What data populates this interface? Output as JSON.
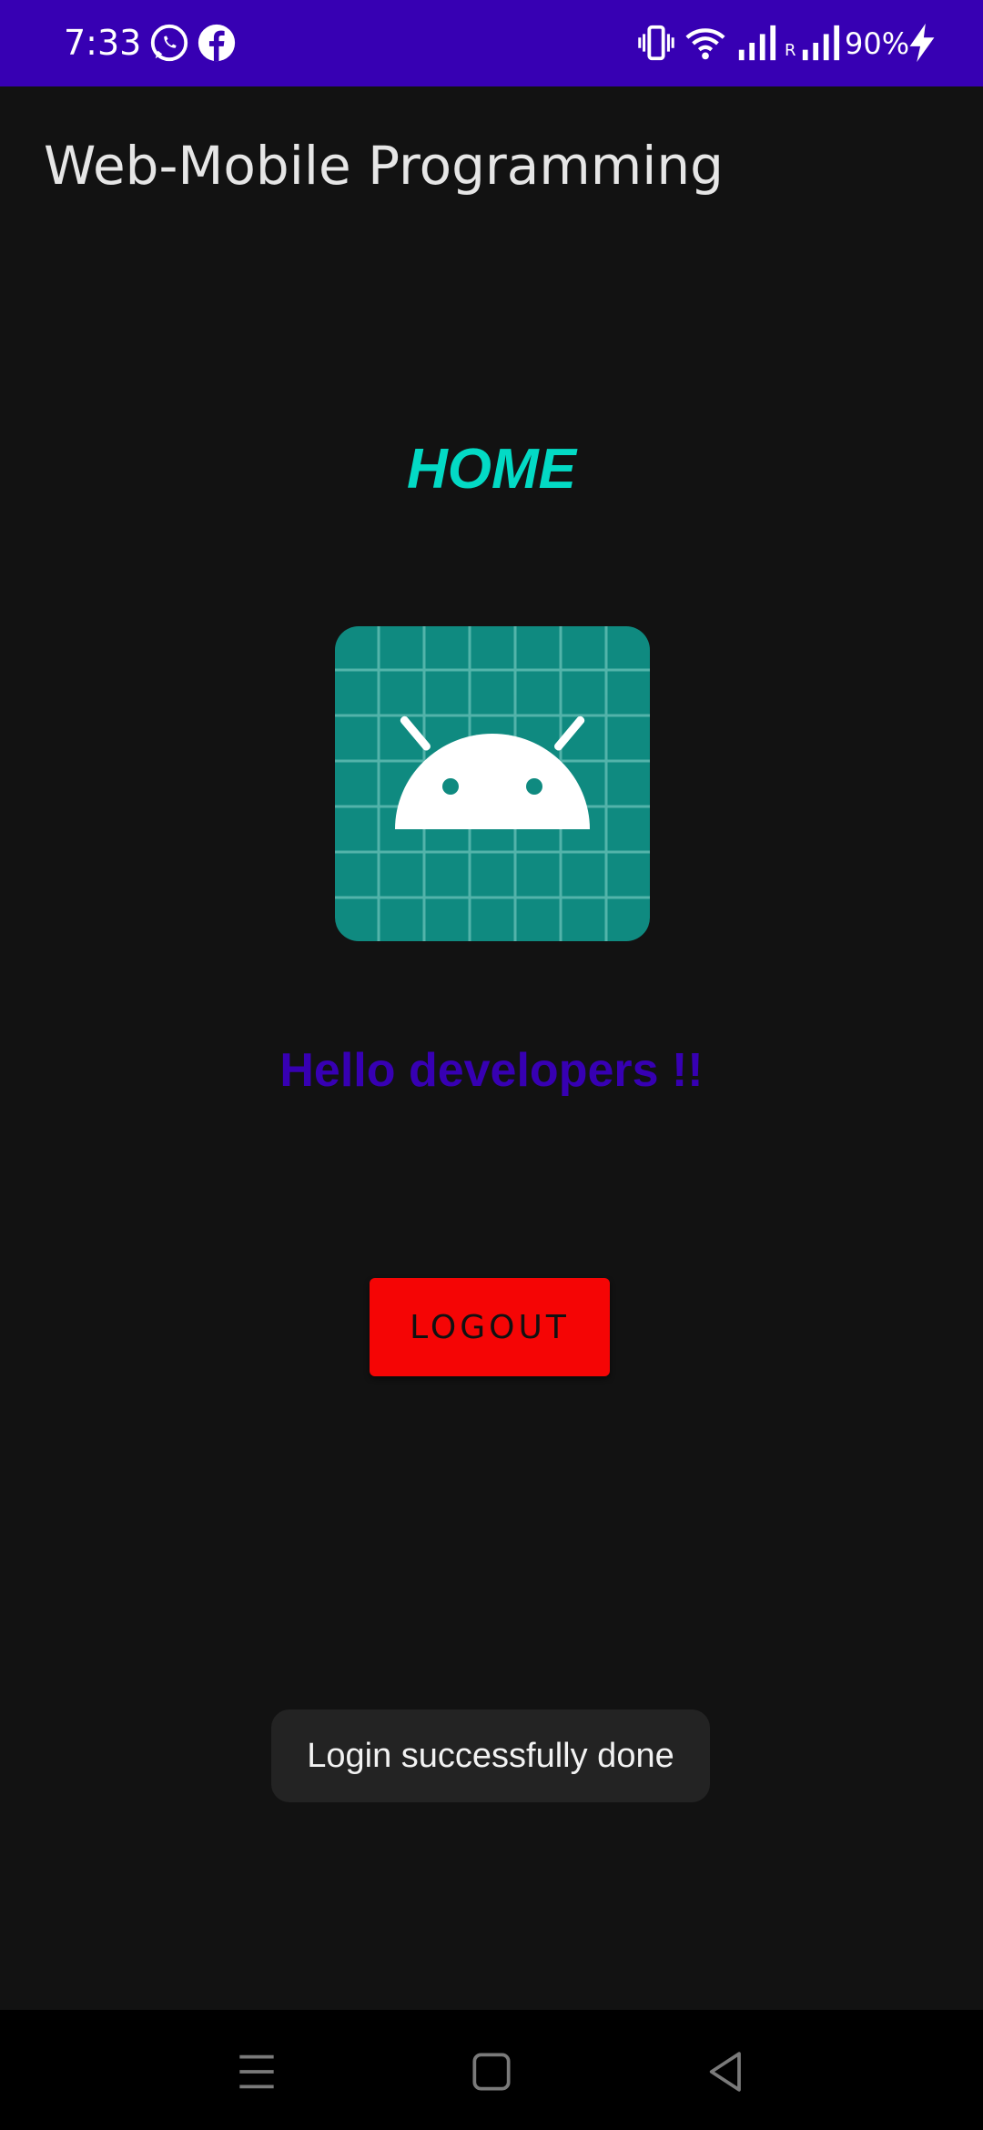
{
  "status_bar": {
    "time": "7:33",
    "battery": "90%",
    "roaming_label": "R",
    "background_color": "#3700B3",
    "icons": [
      "whatsapp-icon",
      "facebook-icon",
      "vibrate-icon",
      "wifi-icon",
      "signal-icon",
      "signal-roaming-icon",
      "charging-icon"
    ]
  },
  "app_bar": {
    "title": "Web-Mobile Programming"
  },
  "main": {
    "heading": "HOME",
    "heading_color": "#03DAC5",
    "logo": "android-logo-icon",
    "greeting": "Hello developers !!",
    "greeting_color": "#3700B3",
    "logout_label": "LOGOUT",
    "logout_color": "#F50505"
  },
  "toast": {
    "message": "Login successfully done"
  },
  "nav_bar": {
    "icons": [
      "menu-icon",
      "home-icon",
      "back-icon"
    ]
  }
}
